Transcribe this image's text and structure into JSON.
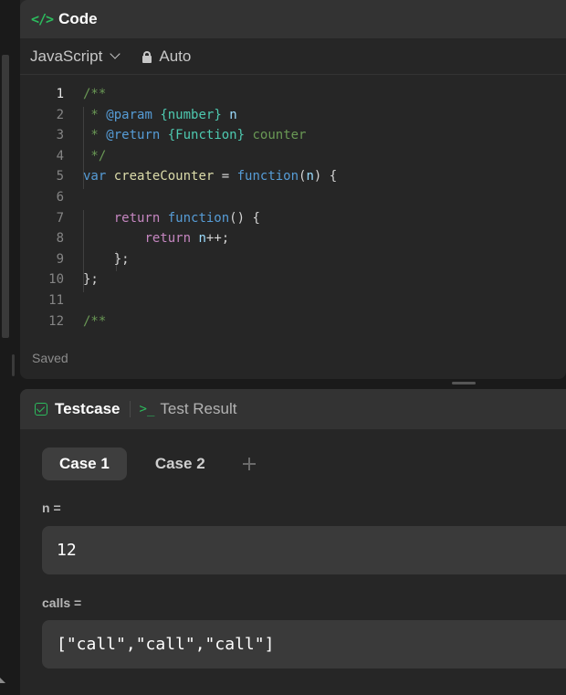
{
  "code_panel": {
    "title": "Code",
    "language": "JavaScript",
    "mode": "Auto",
    "status": "Saved",
    "lines": [
      {
        "n": "1",
        "tokens": [
          {
            "t": "/**",
            "c": "comment"
          }
        ]
      },
      {
        "n": "2",
        "tokens": [
          {
            "t": " * ",
            "c": "comment"
          },
          {
            "t": "@param",
            "c": "kw"
          },
          {
            "t": " ",
            "c": "comment"
          },
          {
            "t": "{number}",
            "c": "type"
          },
          {
            "t": " ",
            "c": "comment"
          },
          {
            "t": "n",
            "c": "param"
          }
        ]
      },
      {
        "n": "3",
        "tokens": [
          {
            "t": " * ",
            "c": "comment"
          },
          {
            "t": "@return",
            "c": "kw"
          },
          {
            "t": " ",
            "c": "comment"
          },
          {
            "t": "{Function}",
            "c": "type"
          },
          {
            "t": " counter",
            "c": "comment"
          }
        ]
      },
      {
        "n": "4",
        "tokens": [
          {
            "t": " */",
            "c": "comment"
          }
        ]
      },
      {
        "n": "5",
        "tokens": [
          {
            "t": "var",
            "c": "kw"
          },
          {
            "t": " ",
            "c": "plain"
          },
          {
            "t": "createCounter",
            "c": "fn"
          },
          {
            "t": " = ",
            "c": "plain"
          },
          {
            "t": "function",
            "c": "kw"
          },
          {
            "t": "(",
            "c": "plain"
          },
          {
            "t": "n",
            "c": "param"
          },
          {
            "t": ") {",
            "c": "plain"
          }
        ]
      },
      {
        "n": "6",
        "tokens": []
      },
      {
        "n": "7",
        "tokens": [
          {
            "t": "    ",
            "c": "plain"
          },
          {
            "t": "return",
            "c": "ctrl"
          },
          {
            "t": " ",
            "c": "plain"
          },
          {
            "t": "function",
            "c": "kw"
          },
          {
            "t": "() {",
            "c": "plain"
          }
        ]
      },
      {
        "n": "8",
        "tokens": [
          {
            "t": "        ",
            "c": "plain"
          },
          {
            "t": "return",
            "c": "ctrl"
          },
          {
            "t": " ",
            "c": "plain"
          },
          {
            "t": "n",
            "c": "param"
          },
          {
            "t": "++;",
            "c": "plain"
          }
        ]
      },
      {
        "n": "9",
        "tokens": [
          {
            "t": "    };",
            "c": "plain"
          }
        ]
      },
      {
        "n": "10",
        "tokens": [
          {
            "t": "};",
            "c": "plain"
          }
        ]
      },
      {
        "n": "11",
        "tokens": []
      },
      {
        "n": "12",
        "tokens": [
          {
            "t": "/**",
            "c": "comment"
          }
        ]
      }
    ]
  },
  "test_panel": {
    "tab_testcase": "Testcase",
    "tab_result": "Test Result",
    "cases": [
      "Case 1",
      "Case 2"
    ],
    "fields": [
      {
        "label": "n =",
        "value": "12"
      },
      {
        "label": "calls =",
        "value": "[\"call\",\"call\",\"call\"]"
      }
    ]
  },
  "colors": {
    "accent_green": "#2cbb5d",
    "panel_bg": "#262626",
    "header_bg": "#333333"
  }
}
